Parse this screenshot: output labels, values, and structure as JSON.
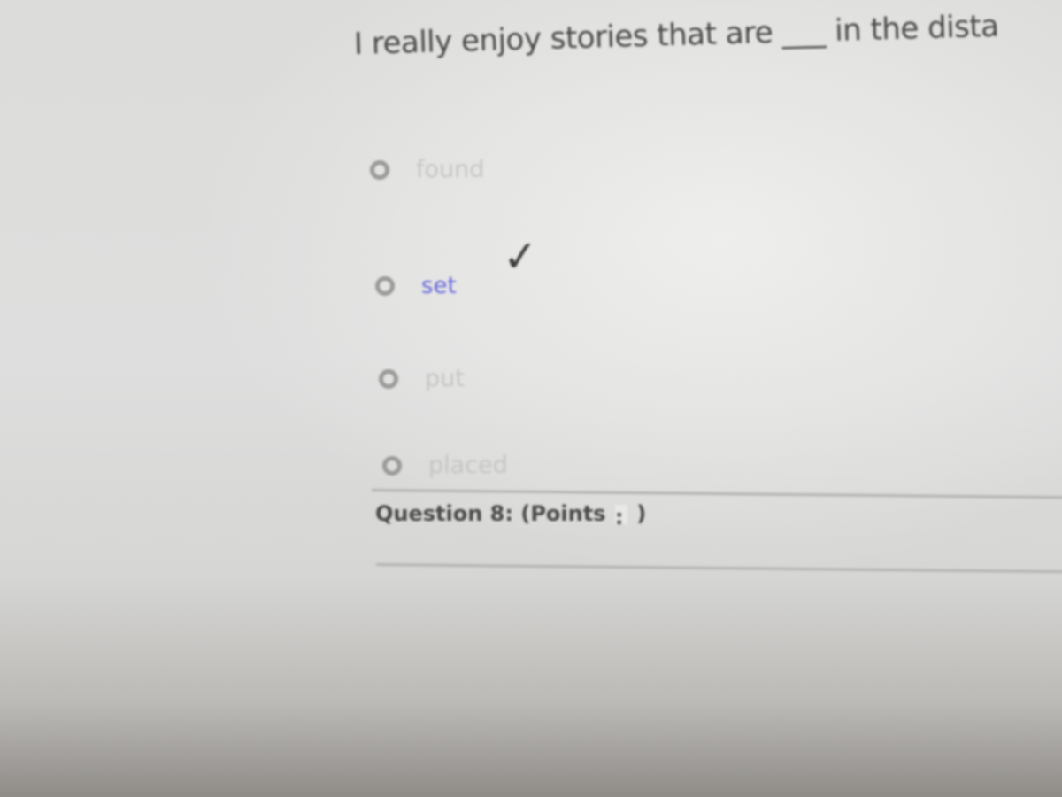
{
  "question": {
    "text": "I really enjoy stories that are ___ in the dista"
  },
  "options": [
    {
      "label": "found",
      "selected": false,
      "correct": false
    },
    {
      "label": "set",
      "selected": false,
      "correct": true
    },
    {
      "label": "put",
      "selected": false,
      "correct": false
    },
    {
      "label": "placed",
      "selected": false,
      "correct": false
    }
  ],
  "feedback": {
    "check_icon": "✓"
  },
  "next_question": {
    "title": "Question 8:",
    "points_open": "(Points",
    "points_value": ":",
    "points_close": ")"
  },
  "colors": {
    "correct_answer": "#6a6adc",
    "option_text": "#c6c6c4",
    "radio_border": "#9a9a98"
  },
  "icons": {
    "radio": "radio-button-icon",
    "check": "check-mark-icon"
  }
}
